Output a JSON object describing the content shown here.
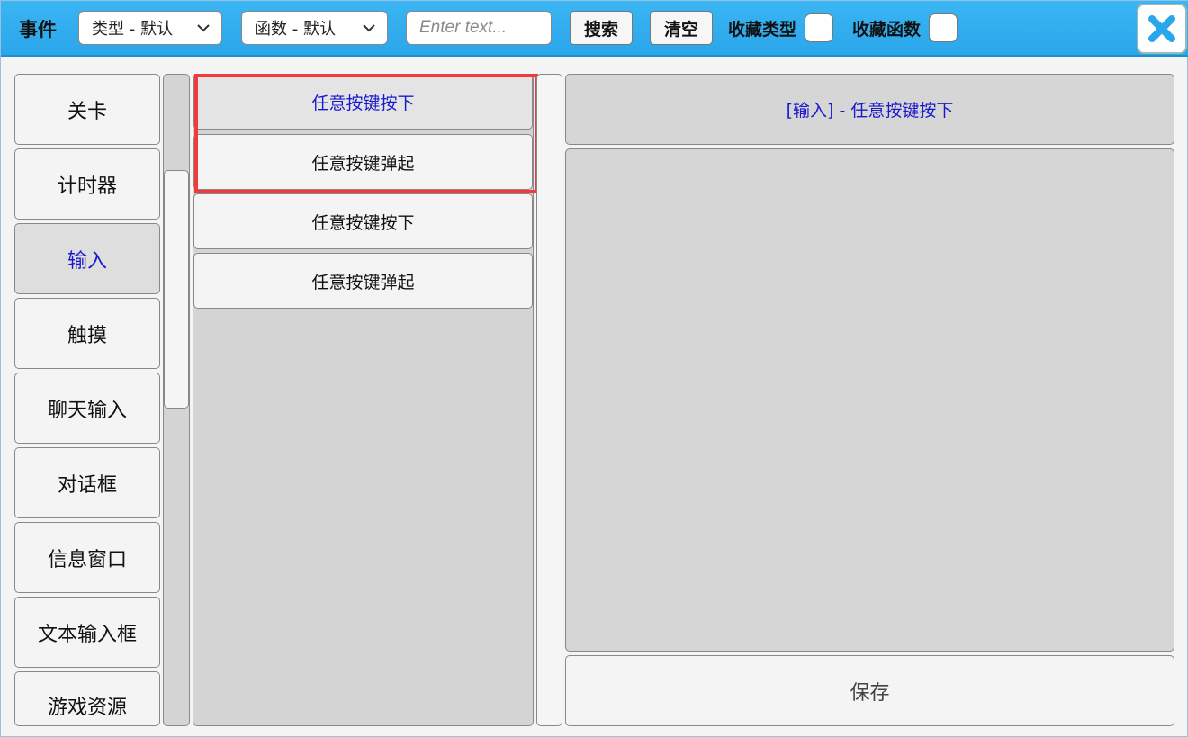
{
  "header": {
    "title": "事件",
    "type_select": "类型 - 默认",
    "function_select": "函数 - 默认",
    "search_placeholder": "Enter text...",
    "search_button": "搜索",
    "clear_button": "清空",
    "fav_type_label": "收藏类型",
    "fav_function_label": "收藏函数",
    "close_icon": "close-x-icon",
    "accent_color": "#2aa6ea"
  },
  "categories": [
    {
      "label": "关卡"
    },
    {
      "label": "计时器"
    },
    {
      "label": "输入",
      "selected": true
    },
    {
      "label": "触摸"
    },
    {
      "label": "聊天输入"
    },
    {
      "label": "对话框"
    },
    {
      "label": "信息窗口"
    },
    {
      "label": "文本输入框"
    },
    {
      "label": "游戏资源"
    }
  ],
  "functions": [
    {
      "label": "任意按键按下",
      "selected": true
    },
    {
      "label": "任意按键弹起"
    },
    {
      "label": "任意按键按下"
    },
    {
      "label": "任意按键弹起"
    }
  ],
  "detail": {
    "title": "[输入] - 任意按键按下",
    "save_button": "保存"
  },
  "colors": {
    "selected_text": "#1a1acc",
    "highlight_box": "#ef3b3b"
  }
}
